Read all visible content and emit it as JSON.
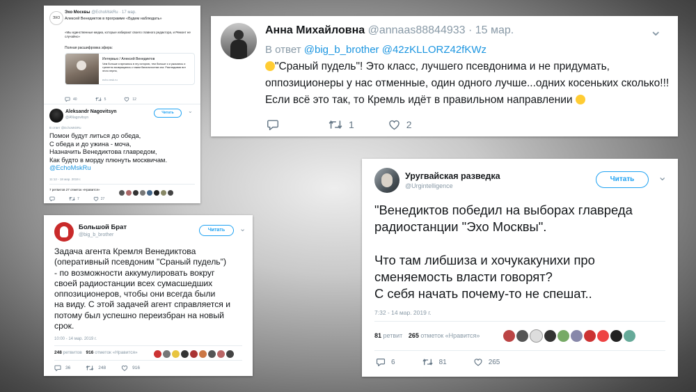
{
  "card1": {
    "name": "Эхо Москвы",
    "handle": "@EchoMskRu",
    "date": "· 17 мар.",
    "text": "Алексей Венедиктов в программе «Будем наблюдать»",
    "quote": "«Мы единственные медиа, которые избирают своего главного редактора, и Ремонт не случайно»",
    "read_more": "Полная расшифровка эфира:",
    "preview_title": "Интервью / Алексей Венедиктов",
    "preview_text": "Чем больше я врезаюсь в эту историю, тем больше я и ужасаюсь и трепетно возвращаюсь к таким банальностям зла. Разглядывая вот этого перня,",
    "preview_domain": "echo.msk.ru",
    "replies": "40",
    "retweets": "5",
    "likes": "12"
  },
  "card1b": {
    "name": "Aleksandr Nagovitsyn",
    "handle": "@ANagovitsyn",
    "follow": "Читать",
    "reply_to": "В ответ @EchoMskRu",
    "lines": [
      "Помои будут литься до обеда,",
      "С обеда и до ужина - моча,",
      "Назначить Венедиктова главредом,",
      "Как будто в морду плюнуть москвичам."
    ],
    "mention": "@EchoMskRu",
    "time": "11:12 - 18 мар. 2019 г.",
    "stats": "7 ретвитов  27 отметок «Нравится»",
    "replies": "",
    "retweets": "7",
    "likes": "27"
  },
  "card2": {
    "name": "Анна Михайловна",
    "handle": "@annaas88844933",
    "date": "· 15 мар.",
    "reply_label": "В ответ",
    "reply_users": "@big_b_brother @42zKLLORZ42fKWz",
    "text1": "\"Сраный пудель\"! Это класс, лучшего псевдонима и не придумать,",
    "text2": "оппозиционеры у нас отменные, один одного лучше...одних косеньких сколько!!!",
    "text3": "Если всё это так, то Кремль идёт в правильном направлении",
    "retweets": "1",
    "likes": "2"
  },
  "card3": {
    "name": "Большой Брат",
    "handle": "@big_b_brother",
    "follow": "Читать",
    "text": [
      "Задача агента Кремля Венедиктова",
      "(оперативный псевдоним \"Сраный пудель\")",
      "- по возможности аккумулировать вокруг",
      "своей радиостанции всех сумасшедших",
      "оппозиционеров, чтобы они всегда были",
      "на виду. С этой задачей агент справляется и",
      "потому был успешно переизбран на новый",
      "срок."
    ],
    "time": "10:00 - 14 мар. 2019 г.",
    "retweets_n": "248",
    "retweets_label": "ретвитов",
    "likes_n": "916",
    "likes_label": "отметок «Нравится»",
    "replies": "36",
    "retweets": "248",
    "likes": "916"
  },
  "card4": {
    "name": "Уругвайская разведка",
    "handle": "@Urgintelligence",
    "follow": "Читать",
    "text": [
      "\"Венедиктов победил на выборах главреда",
      "радиостанции \"Эхо Москвы\".",
      "",
      "Что там либшиза и хочукакунихи про",
      "сменяемость власти говорят?",
      "С себя начать почему-то не спешат.."
    ],
    "time": "7:32 - 14 мар. 2019 г.",
    "retweets_n": "81",
    "retweets_label": "ретвит",
    "likes_n": "265",
    "likes_label": "отметок «Нравится»",
    "replies": "6",
    "retweets": "81",
    "likes": "265"
  },
  "colors": {
    "accent": "#1da1f2",
    "link": "#1b95e0",
    "muted": "#8899a6"
  },
  "icons": [
    "reply-icon",
    "retweet-icon",
    "heart-icon",
    "chevron-down-icon",
    "emoji-icon"
  ]
}
